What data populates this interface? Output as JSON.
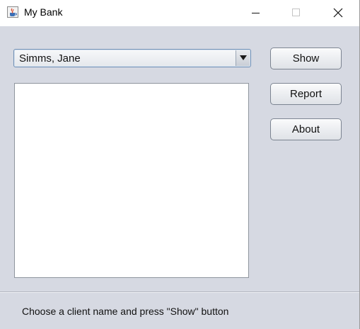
{
  "window": {
    "title": "My Bank",
    "icon": "java-cup-icon",
    "controls": [
      "minimize-icon",
      "maximize-icon",
      "close-icon"
    ]
  },
  "client_select": {
    "selected": "Simms, Jane",
    "icon": "dropdown-arrow-icon"
  },
  "details_list": {
    "items": []
  },
  "buttons": {
    "show": "Show",
    "report": "Report",
    "about": "About"
  },
  "status": {
    "message": "Choose a client name and press \"Show\" button"
  },
  "colors": {
    "window_bg": "#d6d9e2",
    "titlebar_bg": "#ffffff",
    "list_bg": "#ffffff",
    "combo_border": "#6f8fb4"
  }
}
